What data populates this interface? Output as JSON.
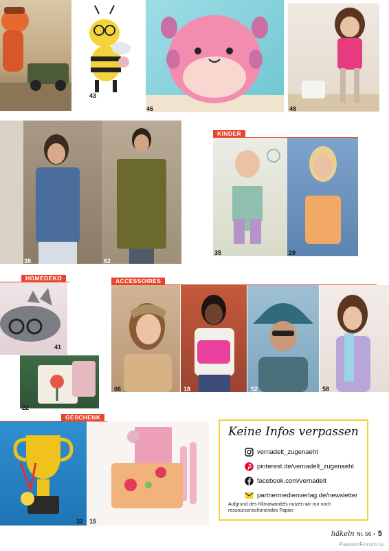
{
  "top_row": {
    "photos": [
      {
        "id": "fox",
        "number": ""
      },
      {
        "id": "bee",
        "number": "43"
      },
      {
        "id": "axolotl",
        "number": "46"
      },
      {
        "id": "doll",
        "number": "48"
      }
    ]
  },
  "fashion": {
    "photos": [
      {
        "id": "blue-top",
        "number": "38"
      },
      {
        "id": "green-tunic",
        "number": "62"
      }
    ]
  },
  "kinder": {
    "label": "KINDER",
    "photos": [
      {
        "id": "romper",
        "number": "35"
      },
      {
        "id": "orange-top",
        "number": "29"
      }
    ]
  },
  "homedeko": {
    "label": "HOMEDEKO",
    "photos": [
      {
        "id": "glasses-case",
        "number": "41"
      },
      {
        "id": "pillow",
        "number": "22"
      }
    ]
  },
  "accessoires": {
    "label": "ACCESSOIRES",
    "photos": [
      {
        "id": "headband",
        "number": "06"
      },
      {
        "id": "bag",
        "number": "18"
      },
      {
        "id": "bucket-hat",
        "number": "52"
      },
      {
        "id": "scarf",
        "number": "58"
      }
    ]
  },
  "geschenk": {
    "label": "GESCHENK",
    "photos": [
      {
        "id": "trophy",
        "number": "32"
      },
      {
        "id": "pouch",
        "number": "15"
      }
    ]
  },
  "info_box": {
    "title": "Keine Infos verpassen",
    "links": [
      {
        "icon": "instagram-icon",
        "text": "vernadelt_zugenaeht"
      },
      {
        "icon": "pinterest-icon",
        "text": "pinterest.de/vernadelt_zugenaeht"
      },
      {
        "icon": "facebook-icon",
        "text": "facebook.com/vernadelt"
      },
      {
        "icon": "mail-icon",
        "text": "partnermedienverlag.de/newsletter"
      }
    ],
    "note": "Aufgrund des Klimawandels nutzen wir nur noch ressourcenschonendes Papier."
  },
  "footer": {
    "magazine": "häkeln",
    "issue": "Nr. 56",
    "bullet": "•",
    "page": "5"
  },
  "watermark": "PassionForum.ru",
  "colors": {
    "accent": "#e8452c",
    "box_border": "#f2d13a"
  }
}
